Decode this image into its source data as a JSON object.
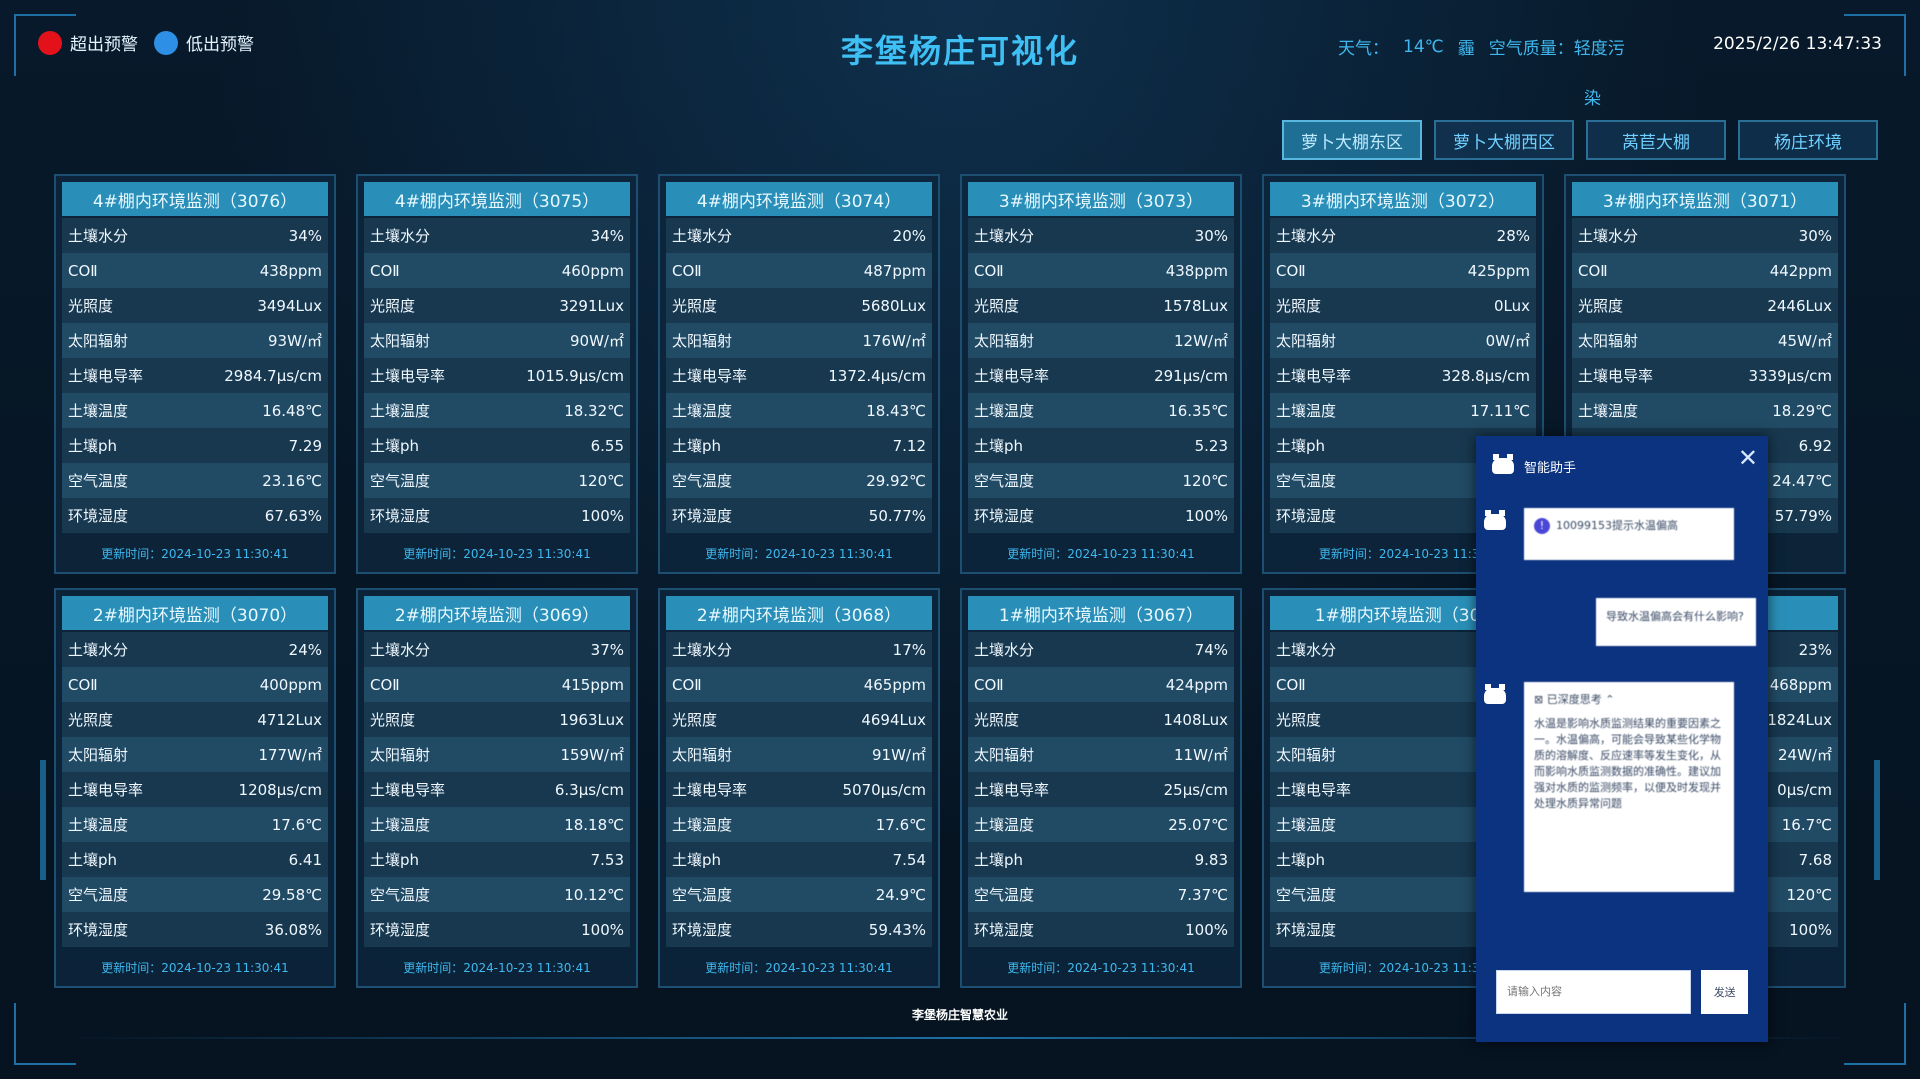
{
  "header": {
    "title": "李堡杨庄可视化",
    "legend": [
      {
        "label": "超出预警",
        "color": "#e3121a"
      },
      {
        "label": "低出预警",
        "color": "#2d8fe6"
      }
    ],
    "weather_label": "天气：",
    "temperature": "14℃",
    "weather_icon": "霾",
    "air_quality": "空气质量：轻度污",
    "air_quality_wrap": "染",
    "datetime": "2025/2/26 13:47:33"
  },
  "tabs": [
    {
      "label": "萝卜大棚东区",
      "active": true
    },
    {
      "label": "萝卜大棚西区",
      "active": false
    },
    {
      "label": "莴苣大棚",
      "active": false
    },
    {
      "label": "杨庄环境",
      "active": false
    }
  ],
  "metric_labels": [
    "土壤水分",
    "COⅡ",
    "光照度",
    "太阳辐射",
    "土壤电导率",
    "土壤温度",
    "土壤ph",
    "空气温度",
    "环境湿度"
  ],
  "cards": [
    {
      "title": "4#棚内环境监测（3076）",
      "values": [
        "34%",
        "438ppm",
        "3494Lux",
        "93W/㎡",
        "2984.7μs/cm",
        "16.48℃",
        "7.29",
        "23.16℃",
        "67.63%"
      ],
      "update": "更新时间：2024-10-23 11:30:41"
    },
    {
      "title": "4#棚内环境监测（3075）",
      "values": [
        "34%",
        "460ppm",
        "3291Lux",
        "90W/㎡",
        "1015.9μs/cm",
        "18.32℃",
        "6.55",
        "120℃",
        "100%"
      ],
      "update": "更新时间：2024-10-23 11:30:41"
    },
    {
      "title": "4#棚内环境监测（3074）",
      "values": [
        "20%",
        "487ppm",
        "5680Lux",
        "176W/㎡",
        "1372.4μs/cm",
        "18.43℃",
        "7.12",
        "29.92℃",
        "50.77%"
      ],
      "update": "更新时间：2024-10-23 11:30:41"
    },
    {
      "title": "3#棚内环境监测（3073）",
      "values": [
        "30%",
        "438ppm",
        "1578Lux",
        "12W/㎡",
        "291μs/cm",
        "16.35℃",
        "5.23",
        "120℃",
        "100%"
      ],
      "update": "更新时间：2024-10-23 11:30:41"
    },
    {
      "title": "3#棚内环境监测（3072）",
      "values": [
        "28%",
        "425ppm",
        "0Lux",
        "0W/㎡",
        "328.8μs/cm",
        "17.11℃",
        "",
        "",
        ""
      ],
      "update": "更新时间：2024-10-23 11:30"
    },
    {
      "title": "3#棚内环境监测（3071）",
      "values": [
        "30%",
        "442ppm",
        "2446Lux",
        "45W/㎡",
        "3339μs/cm",
        "18.29℃",
        "6.92",
        "24.47℃",
        "57.79%"
      ],
      "update": "30:41"
    },
    {
      "title": "2#棚内环境监测（3070）",
      "values": [
        "24%",
        "400ppm",
        "4712Lux",
        "177W/㎡",
        "1208μs/cm",
        "17.6℃",
        "6.41",
        "29.58℃",
        "36.08%"
      ],
      "update": "更新时间：2024-10-23 11:30:41"
    },
    {
      "title": "2#棚内环境监测（3069）",
      "values": [
        "37%",
        "415ppm",
        "1963Lux",
        "159W/㎡",
        "6.3μs/cm",
        "18.18℃",
        "7.53",
        "10.12℃",
        "100%"
      ],
      "update": "更新时间：2024-10-23 11:30:41"
    },
    {
      "title": "2#棚内环境监测（3068）",
      "values": [
        "17%",
        "465ppm",
        "4694Lux",
        "91W/㎡",
        "5070μs/cm",
        "17.6℃",
        "7.54",
        "24.9℃",
        "59.43%"
      ],
      "update": "更新时间：2024-10-23 11:30:41"
    },
    {
      "title": "1#棚内环境监测（3067）",
      "values": [
        "74%",
        "424ppm",
        "1408Lux",
        "11W/㎡",
        "25μs/cm",
        "25.07℃",
        "9.83",
        "7.37℃",
        "100%"
      ],
      "update": "更新时间：2024-10-23 11:30:41"
    },
    {
      "title": "1#棚内环境监测（306",
      "values": [
        "",
        "",
        "",
        "",
        "35",
        "",
        "",
        "",
        ""
      ],
      "update": "更新时间：2024-10-23 11:30"
    },
    {
      "title": "55）",
      "values": [
        "23%",
        "468ppm",
        "1824Lux",
        "24W/㎡",
        "0μs/cm",
        "16.7℃",
        "7.68",
        "120℃",
        "100%"
      ],
      "update": "30:41"
    }
  ],
  "footer": "李堡杨庄智慧农业",
  "assistant": {
    "title": "智能助手",
    "close": "✕",
    "bot_msg_1": "10099153提示水温偏高",
    "user_msg": "导致水温偏高会有什么影响?",
    "thinking": "已深度思考",
    "bot_msg_2": "水温是影响水质监测结果的重要因素之一。水温偏高，可能会导致某些化学物质的溶解度、反应速率等发生变化，从而影响水质监测数据的准确性。建议加强对水质的监测频率，以便及时发现并处理水质异常问题",
    "input_placeholder": "请输入内容",
    "send_label": "发送"
  }
}
